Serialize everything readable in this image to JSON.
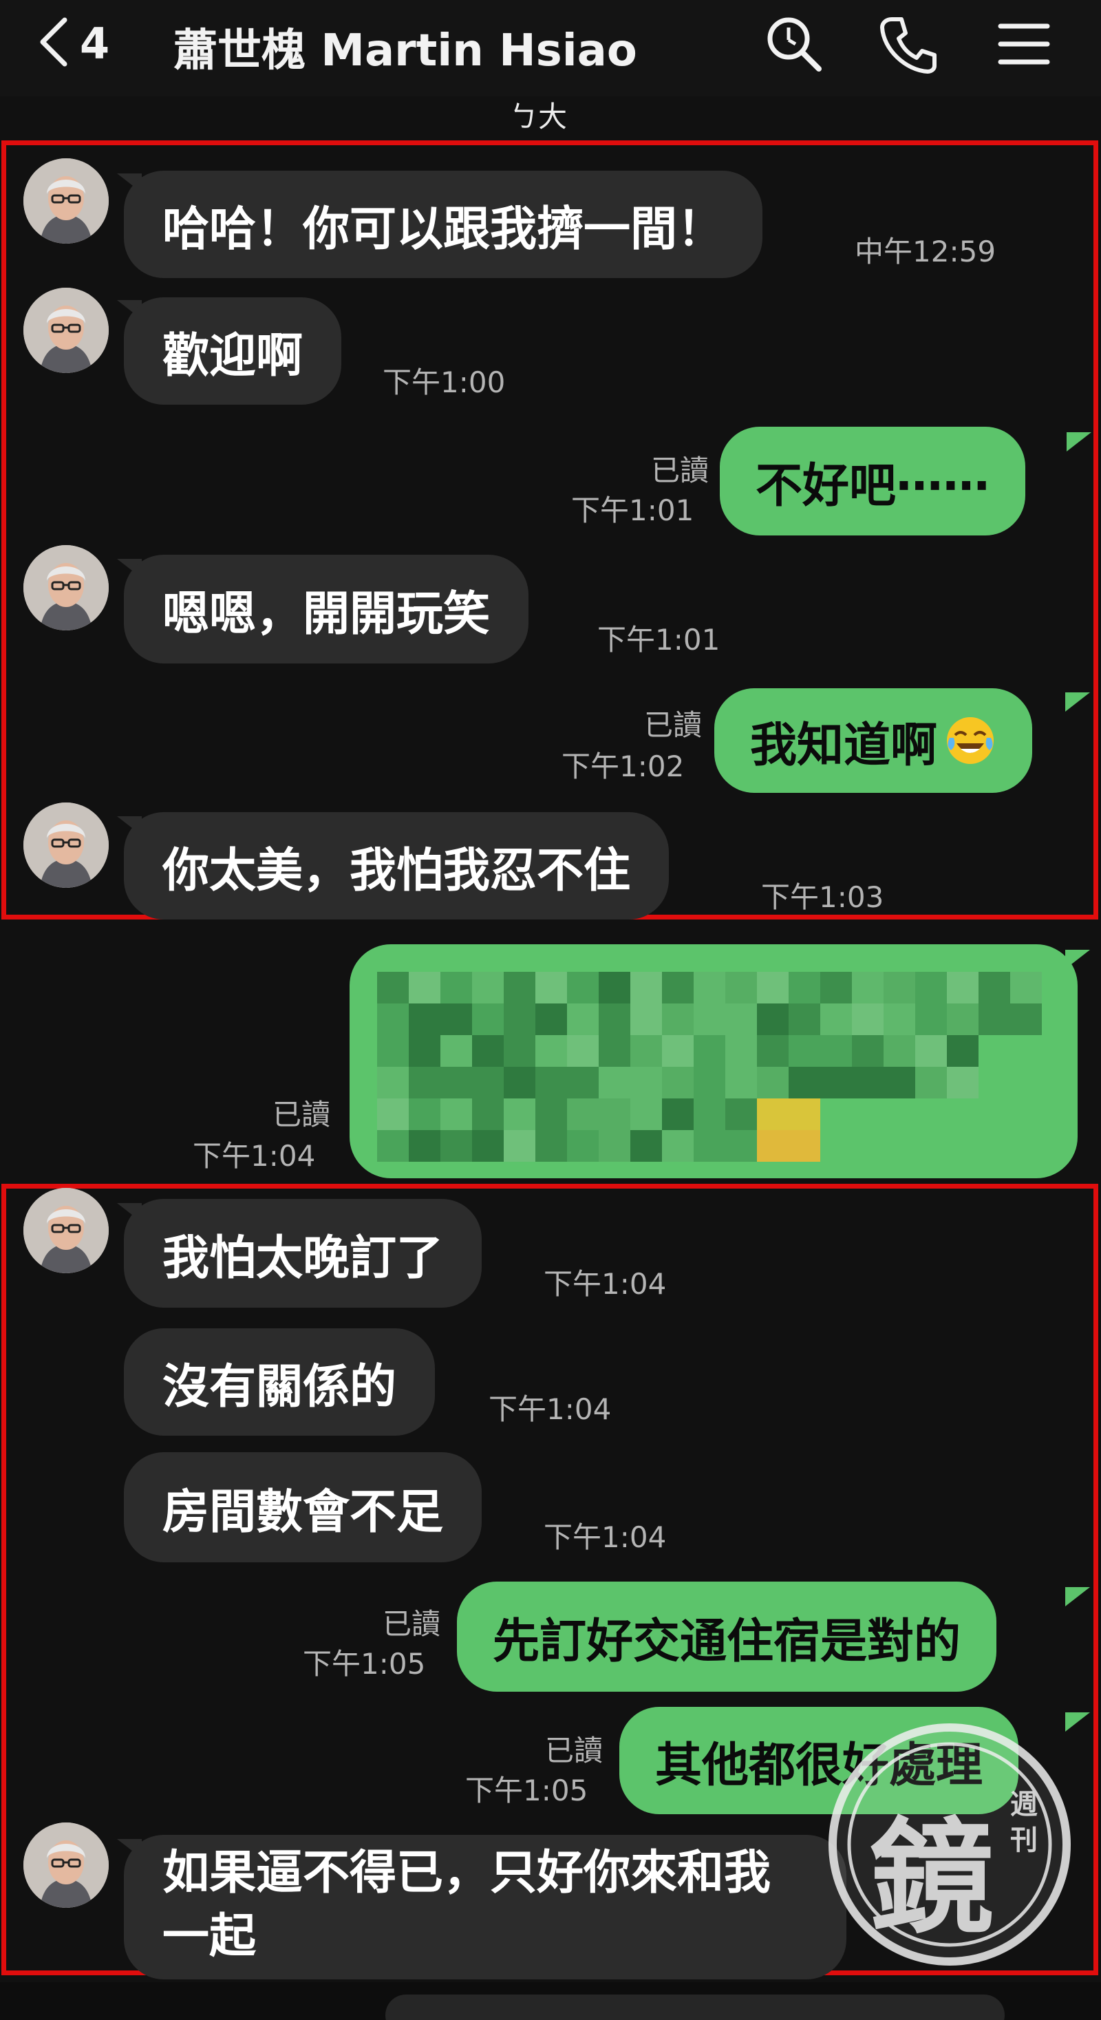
{
  "header": {
    "back_count": "4",
    "title": "蕭世槐 Martin Hsiao",
    "subtext": "ㄅ大"
  },
  "colors": {
    "background": "#111111",
    "incoming_bubble": "#2c2c2c",
    "outgoing_bubble": "#5cc46b",
    "highlight_frame": "#e00d0d"
  },
  "icons": [
    "chevron-left-icon",
    "search-icon",
    "phone-icon",
    "menu-icon",
    "avatar",
    "tears-of-joy-emoji",
    "mirror-media-watermark"
  ],
  "messages": [
    {
      "dir": "in",
      "text": "哈哈！你可以跟我擠一間！",
      "time": "中午12:59"
    },
    {
      "dir": "in",
      "text": "歡迎啊",
      "time": "下午1:00"
    },
    {
      "dir": "out",
      "text": "不好吧⋯⋯",
      "read": "已讀",
      "time": "下午1:01"
    },
    {
      "dir": "in",
      "text": "嗯嗯，開開玩笑",
      "time": "下午1:01"
    },
    {
      "dir": "out",
      "text": "我知道啊",
      "emoji": "😂",
      "read": "已讀",
      "time": "下午1:02"
    },
    {
      "dir": "in",
      "text": "你太美，我怕我忍不住",
      "time": "下午1:03"
    },
    {
      "dir": "out",
      "text": "",
      "redacted": true,
      "read": "已讀",
      "time": "下午1:04"
    },
    {
      "dir": "in",
      "text": "我怕太晚訂了",
      "time": "下午1:04"
    },
    {
      "dir": "in",
      "text": "沒有關係的",
      "time": "下午1:04"
    },
    {
      "dir": "in",
      "text": "房間數會不足",
      "time": "下午1:04"
    },
    {
      "dir": "out",
      "text": "先訂好交通住宿是對的",
      "read": "已讀",
      "time": "下午1:05"
    },
    {
      "dir": "out",
      "text": "其他都很好處理",
      "read": "已讀",
      "time": "下午1:05"
    },
    {
      "dir": "in",
      "text": "如果逼不得已，只好你來和我一起",
      "time": ""
    }
  ],
  "watermark": {
    "main_char": "鏡",
    "side_chars": "週刊"
  }
}
